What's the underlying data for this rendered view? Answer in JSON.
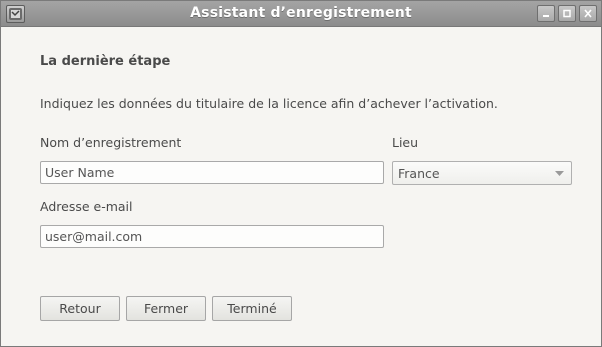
{
  "window": {
    "title": "Assistant d’enregistrement"
  },
  "heading": "La dernière étape",
  "description": "Indiquez les données du titulaire de la licence afin d’achever l’activation.",
  "form": {
    "name_label": "Nom d’enregistrement",
    "name_placeholder": "User Name",
    "location_label": "Lieu",
    "location_value": "France",
    "email_label": "Adresse e-mail",
    "email_placeholder": "user@mail.com"
  },
  "buttons": {
    "back": "Retour",
    "close": "Fermer",
    "finish": "Terminé"
  }
}
